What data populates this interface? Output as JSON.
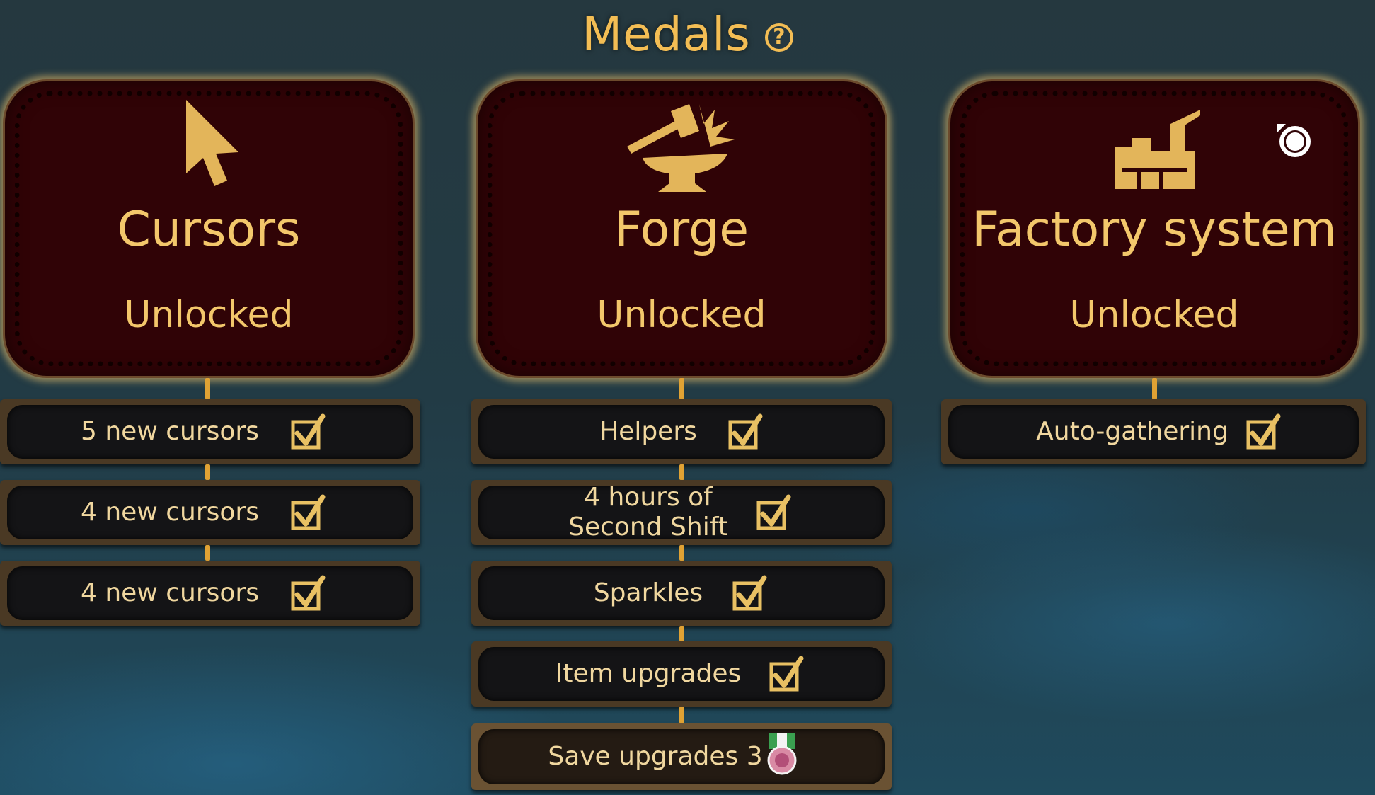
{
  "header": {
    "title": "Medals",
    "help_icon": "question-circle-icon"
  },
  "colors": {
    "gold": "#f3c76b",
    "card_bg": "#300306",
    "row_bg": "#141416",
    "connector": "#e0a234"
  },
  "columns": [
    {
      "name": "Cursors",
      "status": "Unlocked",
      "icon": "cursor-arrow-icon",
      "rows": [
        {
          "label": "5 new cursors",
          "checked": true
        },
        {
          "label": "4 new cursors",
          "checked": true
        },
        {
          "label": "4 new cursors",
          "checked": true
        }
      ]
    },
    {
      "name": "Forge",
      "status": "Unlocked",
      "icon": "anvil-hammer-icon",
      "rows": [
        {
          "label": "Helpers",
          "checked": true
        },
        {
          "label": "4 hours of",
          "label2": "Second Shift",
          "checked": true
        },
        {
          "label": "Sparkles",
          "checked": true
        },
        {
          "label": "Item upgrades",
          "checked": true
        },
        {
          "label": "Save upgrades 3",
          "checked": false,
          "badge": "medal-icon"
        }
      ]
    },
    {
      "name": "Factory system",
      "status": "Unlocked",
      "icon": "factory-icon",
      "overlay_icon": "record-icon",
      "rows": [
        {
          "label": "Auto-gathering",
          "checked": true
        }
      ]
    }
  ]
}
